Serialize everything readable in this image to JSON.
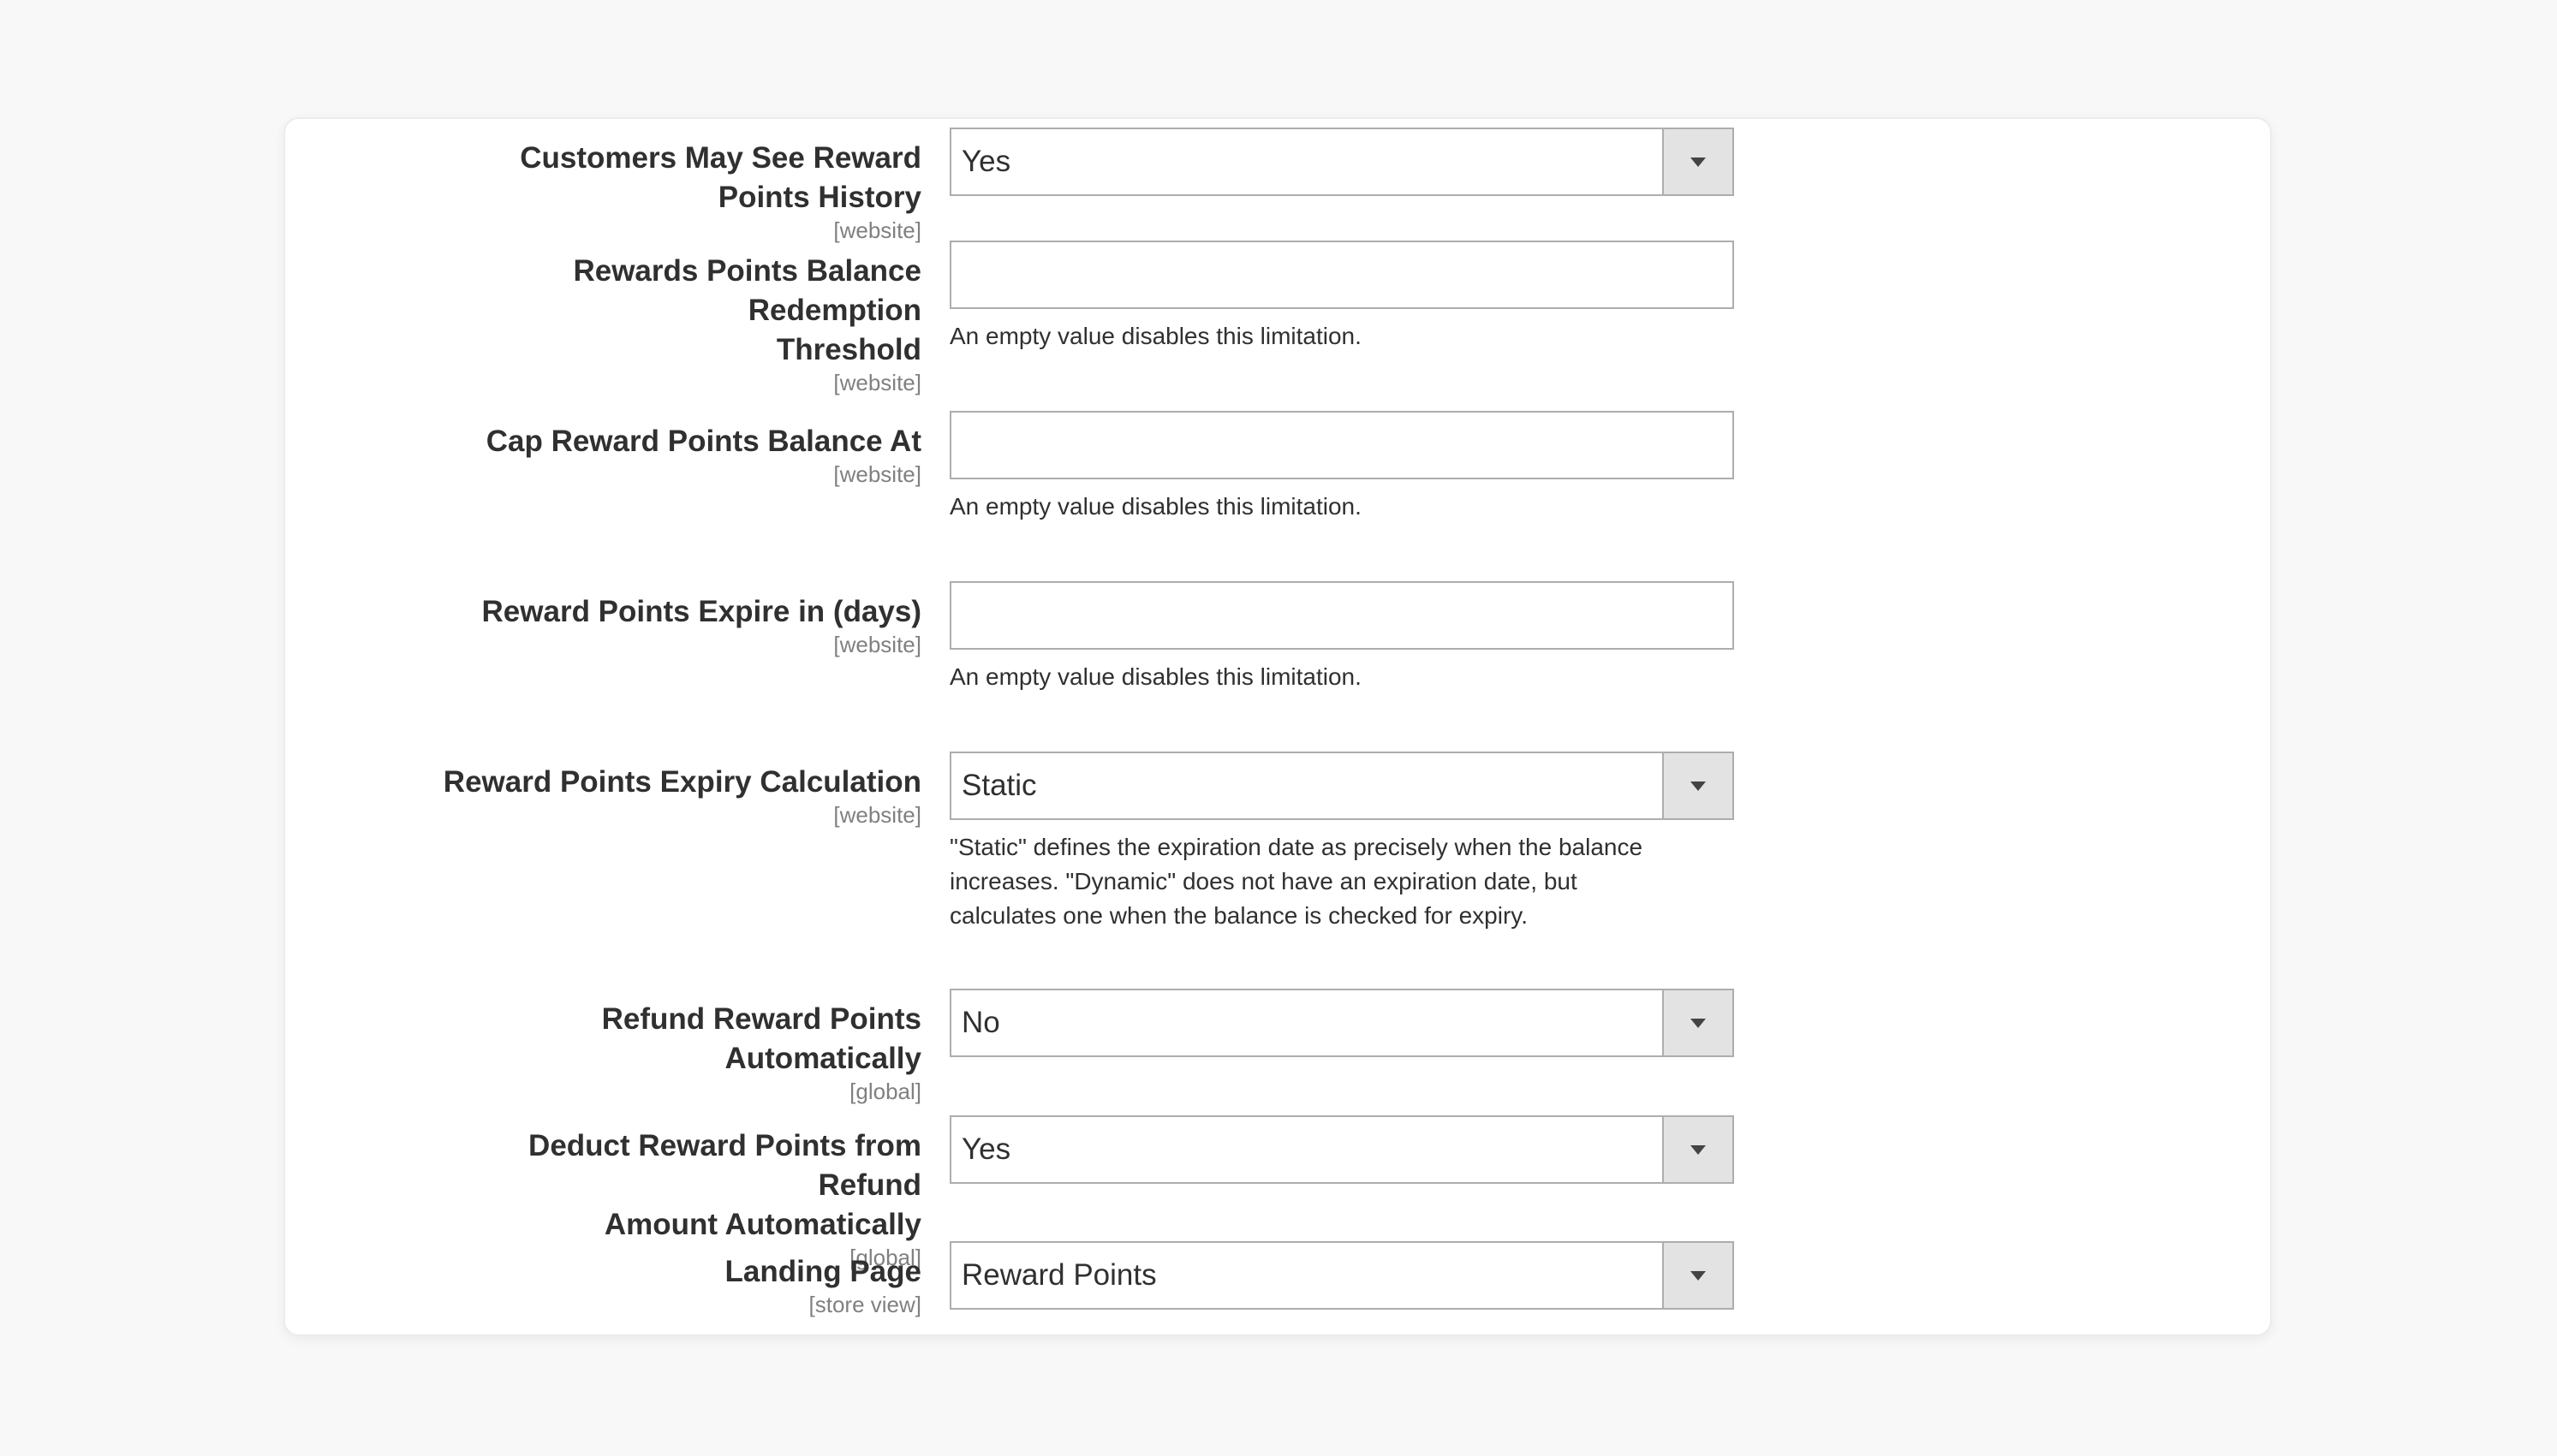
{
  "fields": [
    {
      "label": "Customers May See Reward Points History",
      "scope": "[website]",
      "type": "select",
      "value": "Yes"
    },
    {
      "label_line1": "Rewards Points Balance Redemption",
      "label_line2": "Threshold",
      "scope": "[website]",
      "type": "text",
      "value": "",
      "note": "An empty value disables this limitation."
    },
    {
      "label": "Cap Reward Points Balance At",
      "scope": "[website]",
      "type": "text",
      "value": "",
      "note": "An empty value disables this limitation."
    },
    {
      "label": "Reward Points Expire in (days)",
      "scope": "[website]",
      "type": "text",
      "value": "",
      "note": "An empty value disables this limitation."
    },
    {
      "label": "Reward Points Expiry Calculation",
      "scope": "[website]",
      "type": "select",
      "value": "Static",
      "note_line1": "\"Static\" defines the expiration date as precisely when the balance",
      "note_line2": "increases. \"Dynamic\" does not have an expiration date, but",
      "note_line3": "calculates one when the balance is checked for expiry."
    },
    {
      "label": "Refund Reward Points Automatically",
      "scope": "[global]",
      "type": "select",
      "value": "No"
    },
    {
      "label_line1": "Deduct Reward Points from Refund",
      "label_line2": "Amount Automatically",
      "scope": "[global]",
      "type": "select",
      "value": "Yes"
    },
    {
      "label": "Landing Page",
      "scope": "[store view]",
      "type": "select",
      "value": "Reward Points"
    }
  ],
  "icons": {
    "select_arrow": "chevron-down-icon"
  },
  "colors": {
    "page_background": "#f8f8f8",
    "panel_background": "#ffffff",
    "field_border": "#adadad",
    "select_button": "#e3e3e3"
  }
}
